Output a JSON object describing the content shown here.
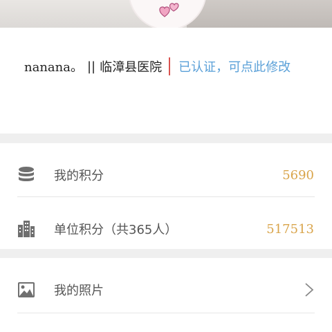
{
  "user": {
    "name": "nanana。",
    "separator": "||",
    "organization": "临漳县医院",
    "certification": "已认证，可点此修改"
  },
  "menu": {
    "my_points": {
      "label": "我的积分",
      "value": "5690",
      "icon": "database-stack-icon"
    },
    "unit_points": {
      "label": "单位积分（共365人）",
      "value": "517513",
      "icon": "building-icon"
    },
    "my_photos": {
      "label": "我的照片",
      "icon": "image-icon"
    }
  },
  "colors": {
    "value": "#d9a44a",
    "certification": "#5aa0d8",
    "divider_accent": "#d9534f",
    "section_gap": "#efefef"
  }
}
